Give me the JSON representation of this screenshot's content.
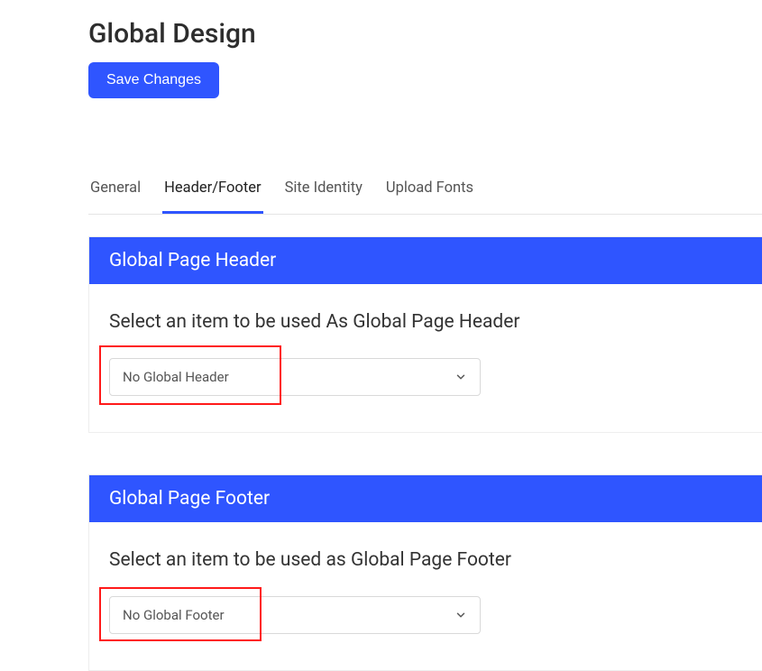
{
  "page_title": "Global Design",
  "save_button_label": "Save Changes",
  "tabs": {
    "general": "General",
    "header_footer": "Header/Footer",
    "site_identity": "Site Identity",
    "upload_fonts": "Upload Fonts"
  },
  "header_panel": {
    "title": "Global Page Header",
    "prompt": "Select an item to be used As Global Page Header",
    "select_value": "No Global Header"
  },
  "footer_panel": {
    "title": "Global Page Footer",
    "prompt": "Select an item to be used as Global Page Footer",
    "select_value": "No Global Footer"
  }
}
